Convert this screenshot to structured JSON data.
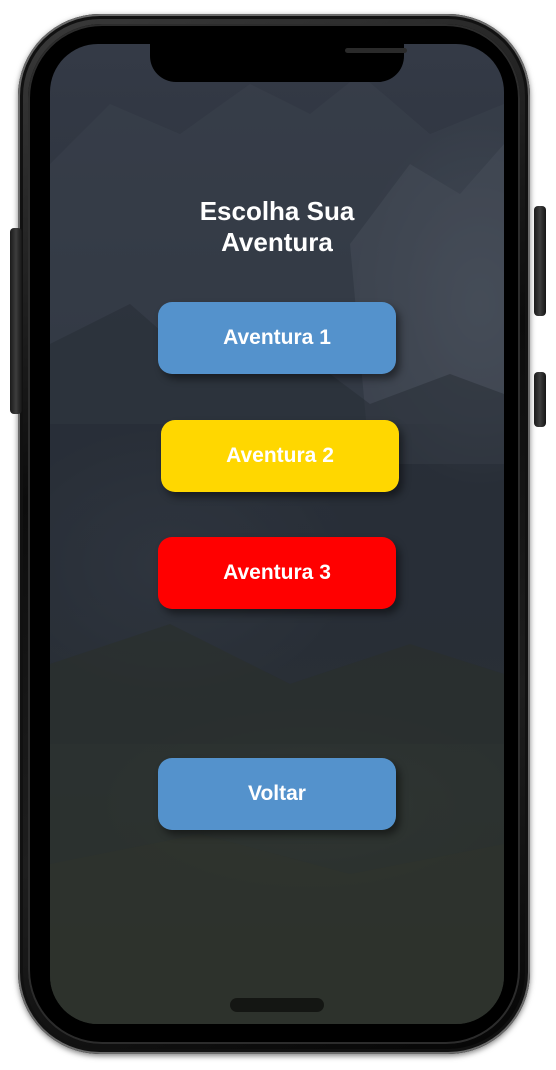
{
  "screen": {
    "title_line1": "Escolha Sua",
    "title_line2": "Aventura"
  },
  "buttons": [
    {
      "label": "Aventura 1",
      "color": "#5492cc"
    },
    {
      "label": "Aventura 2",
      "color": "#ffd700"
    },
    {
      "label": "Aventura 3",
      "color": "#ff0000"
    },
    {
      "label": "Voltar",
      "color": "#5492cc"
    }
  ]
}
